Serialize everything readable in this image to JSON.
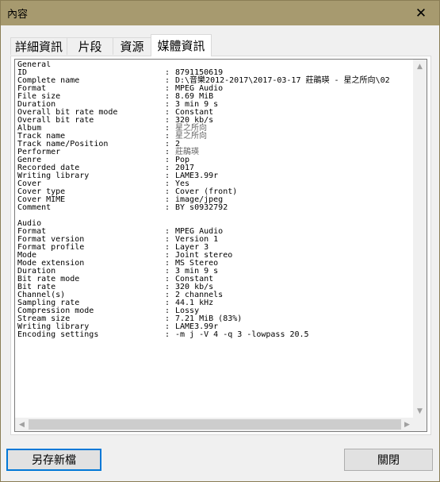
{
  "window": {
    "title": "內容",
    "close_glyph": "✕"
  },
  "tabs": [
    {
      "label": "詳細資訊"
    },
    {
      "label": "片段"
    },
    {
      "label": "資源"
    },
    {
      "label": "媒體資訊",
      "active": true
    }
  ],
  "mediainfo": {
    "general_header": "General",
    "general": [
      {
        "key": "ID",
        "value": "8791150619"
      },
      {
        "key": "Complete name",
        "value": "D:\\音樂2012-2017\\2017-03-17 莊鵑瑛 - 星之所向\\02"
      },
      {
        "key": "Format",
        "value": "MPEG Audio"
      },
      {
        "key": "File size",
        "value": "8.69 MiB"
      },
      {
        "key": "Duration",
        "value": "3 min 9 s"
      },
      {
        "key": "Overall bit rate mode",
        "value": "Constant"
      },
      {
        "key": "Overall bit rate",
        "value": "320 kb/s"
      },
      {
        "key": "Album",
        "value": "星之所向",
        "gray": true
      },
      {
        "key": "Track name",
        "value": "星之所向",
        "gray": true
      },
      {
        "key": "Track name/Position",
        "value": "2"
      },
      {
        "key": "Performer",
        "value": "莊鵑瑛",
        "gray": true
      },
      {
        "key": "Genre",
        "value": "Pop"
      },
      {
        "key": "Recorded date",
        "value": "2017"
      },
      {
        "key": "Writing library",
        "value": "LAME3.99r"
      },
      {
        "key": "Cover",
        "value": "Yes"
      },
      {
        "key": "Cover type",
        "value": "Cover (front)"
      },
      {
        "key": "Cover MIME",
        "value": "image/jpeg"
      },
      {
        "key": "Comment",
        "value": "BY s0932792"
      }
    ],
    "audio_header": "Audio",
    "audio": [
      {
        "key": "Format",
        "value": "MPEG Audio"
      },
      {
        "key": "Format version",
        "value": "Version 1"
      },
      {
        "key": "Format profile",
        "value": "Layer 3"
      },
      {
        "key": "Mode",
        "value": "Joint stereo"
      },
      {
        "key": "Mode extension",
        "value": "MS Stereo"
      },
      {
        "key": "Duration",
        "value": "3 min 9 s"
      },
      {
        "key": "Bit rate mode",
        "value": "Constant"
      },
      {
        "key": "Bit rate",
        "value": "320 kb/s"
      },
      {
        "key": "Channel(s)",
        "value": "2 channels"
      },
      {
        "key": "Sampling rate",
        "value": "44.1 kHz"
      },
      {
        "key": "Compression mode",
        "value": "Lossy"
      },
      {
        "key": "Stream size",
        "value": "7.21 MiB (83%)"
      },
      {
        "key": "Writing library",
        "value": "LAME3.99r"
      },
      {
        "key": "Encoding settings",
        "value": "-m j -V 4 -q 3 -lowpass 20.5"
      }
    ],
    "separator": ":"
  },
  "buttons": {
    "save_new": "另存新檔",
    "close": "關閉"
  },
  "colors": {
    "titlebar": "#a79a6f",
    "accent": "#0078d7"
  }
}
